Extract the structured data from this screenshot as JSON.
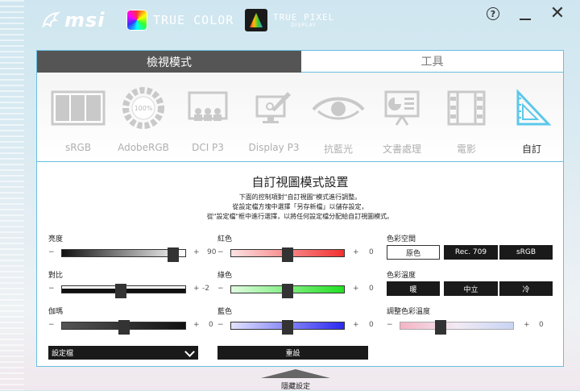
{
  "header": {
    "brand": "msi",
    "true_color": "TRUE COLOR",
    "true_pixel": "TRUE PIXEL",
    "true_pixel_sub": "DISPLAY",
    "help": "?",
    "close": "✕"
  },
  "tabs": [
    {
      "label": "檢視模式",
      "active": true
    },
    {
      "label": "工具",
      "active": false
    }
  ],
  "modes": [
    {
      "label": "sRGB",
      "icon": "srgb-panels-icon"
    },
    {
      "label": "AdobeRGB",
      "icon": "adobergb-100-icon",
      "icon_text": "100%"
    },
    {
      "label": "DCI P3",
      "icon": "cinema-icon"
    },
    {
      "label": "Display P3",
      "icon": "display-p3-icon"
    },
    {
      "label": "抗藍光",
      "icon": "eye-icon"
    },
    {
      "label": "文書處理",
      "icon": "office-chart-icon"
    },
    {
      "label": "電影",
      "icon": "film-icon"
    },
    {
      "label": "自訂",
      "icon": "custom-ruler-icon",
      "selected": true
    }
  ],
  "settings": {
    "title": "自訂視圖模式設置",
    "desc1": "下面的控制項對\"自訂視圖\"模式進行調整。",
    "desc2": "從設定檔方塊中選擇「另存新檔」以儲存設定，",
    "desc3": "從\"設定檔\"框中進行選擇，以將任何設定檔分配給自訂視圖模式。",
    "brightness": {
      "label": "亮度",
      "value": "90",
      "level": 90
    },
    "contrast": {
      "label": "對比",
      "value": "-2",
      "level": 48
    },
    "gamma": {
      "label": "伽瑪",
      "value": "0",
      "level": 50
    },
    "red": {
      "label": "紅色",
      "value": "0",
      "level": 50
    },
    "green": {
      "label": "綠色",
      "value": "0",
      "level": 50
    },
    "blue": {
      "label": "藍色",
      "value": "0",
      "level": 50
    },
    "tone": {
      "label": "調整色彩溫度",
      "value": "0",
      "level": 36
    },
    "minus": "−",
    "plus": "+",
    "color_space": {
      "label": "色彩空間",
      "options": [
        "原色",
        "Rec. 709",
        "sRGB"
      ]
    },
    "color_temp": {
      "label": "色彩溫度",
      "options": [
        "暖",
        "中立",
        "冷"
      ]
    },
    "profile": "設定檔",
    "reset": "重設"
  },
  "footer": {
    "hide": "隱藏設定"
  }
}
